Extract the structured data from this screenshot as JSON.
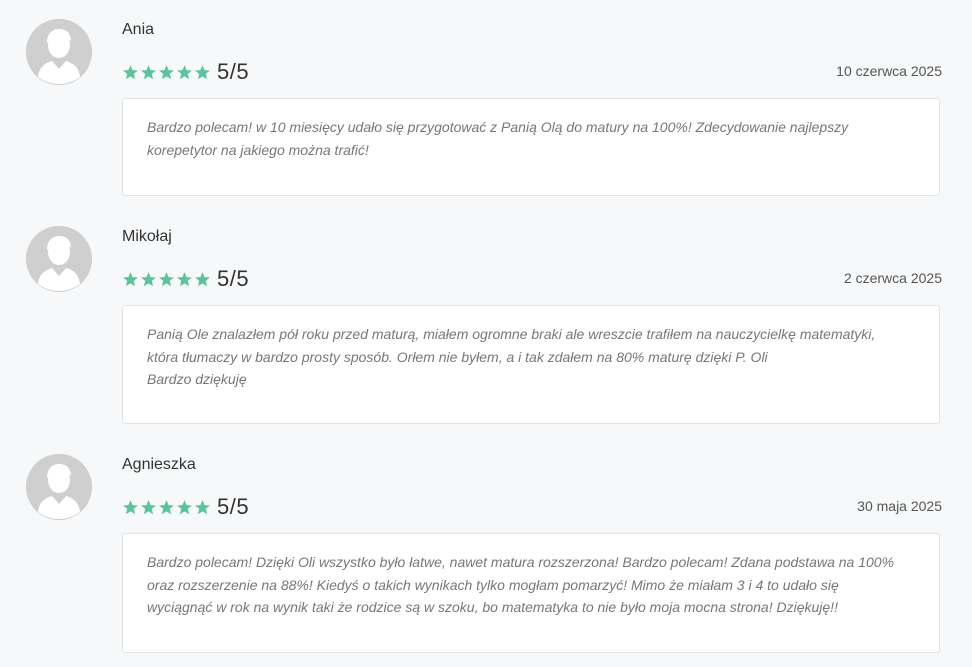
{
  "colors": {
    "star": "#5dc39b",
    "avatar_bg": "#cfcfcf"
  },
  "icons": {
    "avatar": "user-avatar-icon",
    "star": "star-icon"
  },
  "reviews": [
    {
      "name": "Ania",
      "rating": 5,
      "score": "5/5",
      "date": "10 czerwca 2025",
      "text": "Bardzo polecam! w 10 miesięcy udało się przygotować z Panią Olą do matury na 100%! Zdecydowanie najlepszy\nkorepetytor na jakiego można trafić!"
    },
    {
      "name": "Mikołaj",
      "rating": 5,
      "score": "5/5",
      "date": "2 czerwca 2025",
      "text": "Panią Ole znalazłem pół roku przed maturą, miałem ogromne braki ale wreszcie trafiłem na nauczycielkę matematyki,\nktóra tłumaczy w bardzo prosty sposób. Orłem nie byłem, a i tak zdałem na 80% maturę dzięki P. Oli\nBardzo dziękuję"
    },
    {
      "name": "Agnieszka",
      "rating": 5,
      "score": "5/5",
      "date": "30 maja 2025",
      "text": "Bardzo polecam! Dzięki Oli wszystko było łatwe, nawet matura rozszerzona! Bardzo polecam! Zdana podstawa na 100%\noraz rozszerzenie na 88%! Kiedyś o takich wynikach tylko mogłam pomarzyć! Mimo że miałam 3 i 4 to udało się\nwyciągnąć w rok na wynik taki że rodzice są w szoku, bo matematyka to nie było moja mocna strona! Dziękuję!!"
    }
  ]
}
